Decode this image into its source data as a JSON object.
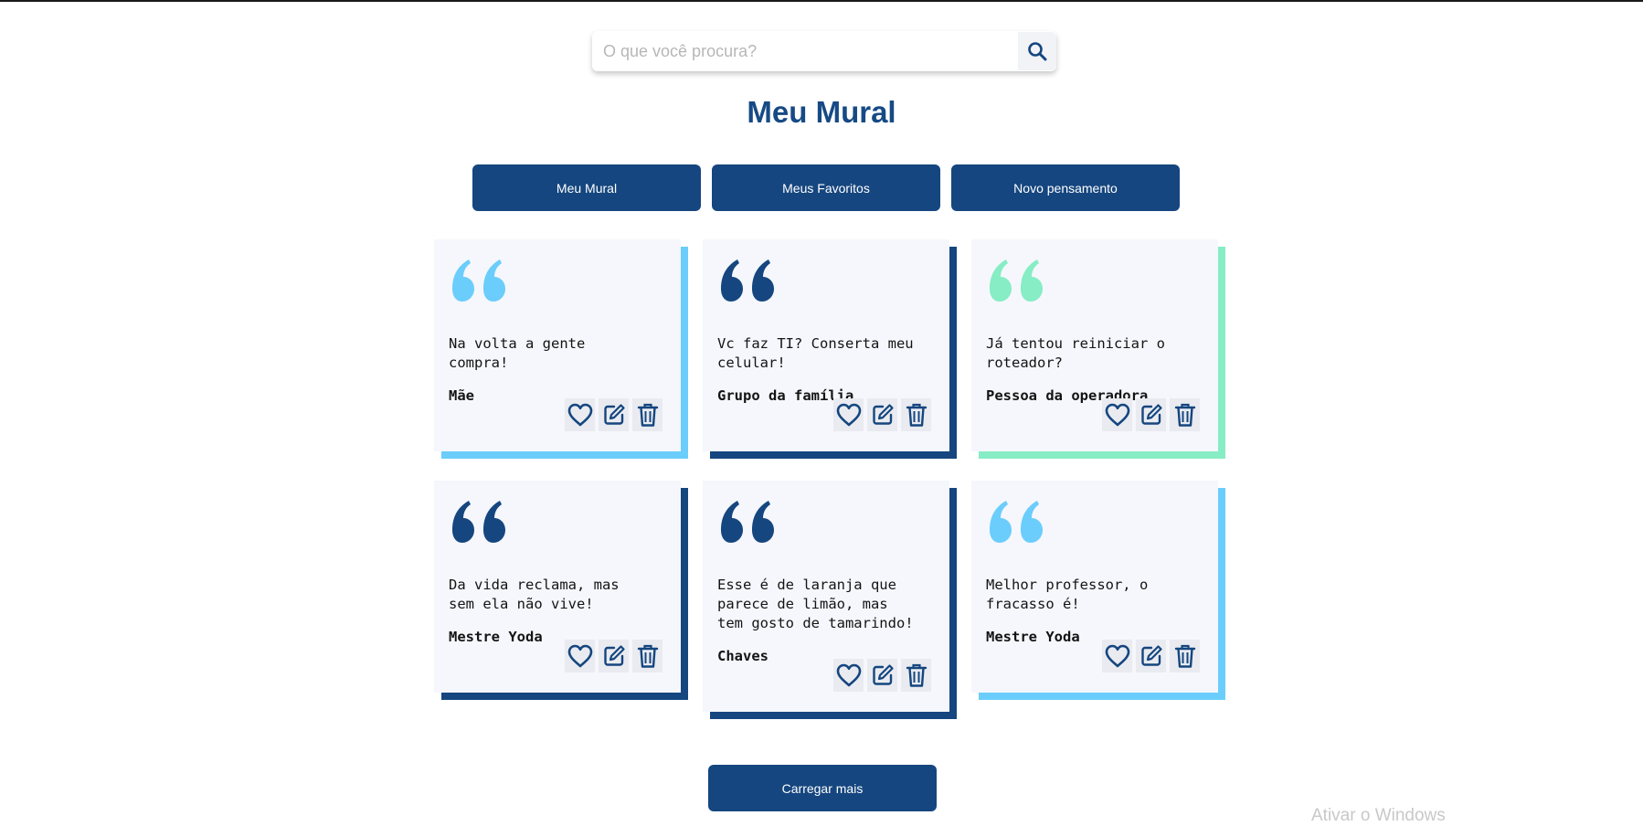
{
  "search": {
    "placeholder": "O que você procura?",
    "icon": "search-icon"
  },
  "page": {
    "title": "Meu Mural"
  },
  "nav": {
    "mural": "Meu Mural",
    "favorites": "Meus Favoritos",
    "new_thought": "Novo pensamento"
  },
  "colors": {
    "primary": "#15467f",
    "light_blue": "#6bcdfb",
    "mint": "#86edc4",
    "card_bg": "#f5f7fc"
  },
  "cards": [
    {
      "text": "Na volta a gente\ncompra!",
      "author": "Mãe",
      "accent": "#6bcdfb"
    },
    {
      "text": "Vc faz TI? Conserta meu\ncelular!",
      "author": "Grupo da família",
      "accent": "#15467f"
    },
    {
      "text": "Já tentou reiniciar o\nroteador?",
      "author": "Pessoa da operadora",
      "accent": "#86edc4"
    },
    {
      "text": "Da vida reclama, mas\nsem ela não vive!",
      "author": "Mestre Yoda",
      "accent": "#15467f"
    },
    {
      "text": "Esse é de laranja que\nparece de limão, mas\ntem gosto de tamarindo!",
      "author": "Chaves",
      "accent": "#15467f"
    },
    {
      "text": "Melhor professor, o\nfracasso é!",
      "author": "Mestre Yoda",
      "accent": "#6bcdfb"
    }
  ],
  "card_actions": [
    "heart-icon",
    "edit-icon",
    "trash-icon"
  ],
  "load_more": "Carregar mais",
  "watermark": "Ativar o Windows"
}
